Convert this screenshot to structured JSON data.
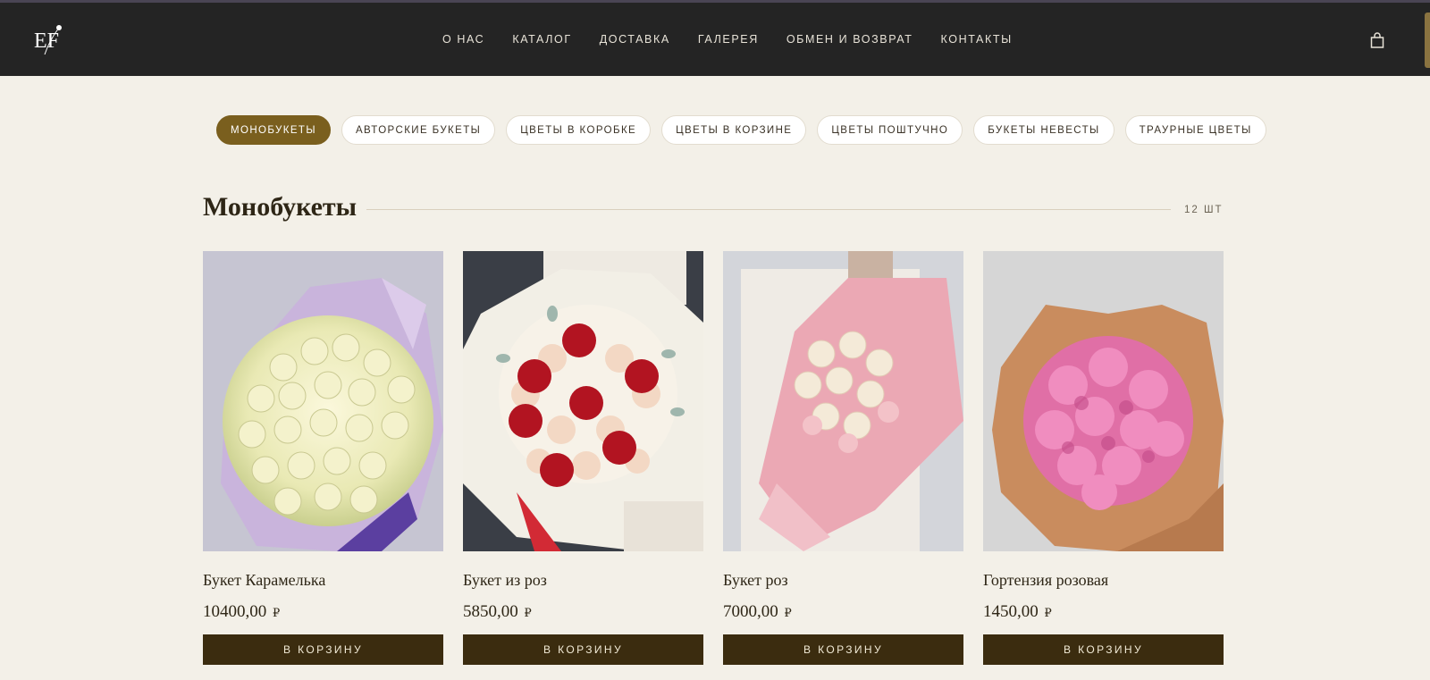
{
  "header": {
    "logo_text": "EF",
    "nav": [
      "О НАС",
      "КАТАЛОГ",
      "ДОСТАВКА",
      "ГАЛЕРЕЯ",
      "ОБМЕН И ВОЗВРАТ",
      "КОНТАКТЫ"
    ],
    "cart_icon": "shopping-bag-icon"
  },
  "filters": [
    {
      "label": "МОНОБУКЕТЫ",
      "active": true
    },
    {
      "label": "АВТОРСКИЕ БУКЕТЫ",
      "active": false
    },
    {
      "label": "ЦВЕТЫ В КОРОБКЕ",
      "active": false
    },
    {
      "label": "ЦВЕТЫ В КОРЗИНЕ",
      "active": false
    },
    {
      "label": "ЦВЕТЫ ПОШТУЧНО",
      "active": false
    },
    {
      "label": "БУКЕТЫ НЕВЕСТЫ",
      "active": false
    },
    {
      "label": "ТРАУРНЫЕ ЦВЕТЫ",
      "active": false
    }
  ],
  "section": {
    "title": "Монобукеты",
    "count": "12 ШТ"
  },
  "products": [
    {
      "name": "Букет Карамелька",
      "price": "10400,00",
      "currency": "₽",
      "button": "В КОРЗИНУ"
    },
    {
      "name": "Букет из роз",
      "price": "5850,00",
      "currency": "₽",
      "button": "В КОРЗИНУ"
    },
    {
      "name": "Букет роз",
      "price": "7000,00",
      "currency": "₽",
      "button": "В КОРЗИНУ"
    },
    {
      "name": "Гортензия розовая",
      "price": "1450,00",
      "currency": "₽",
      "button": "В КОРЗИНУ"
    }
  ],
  "colors": {
    "header_bg": "#242424",
    "page_bg": "#f3f0e8",
    "accent": "#7a5f1e",
    "button_bg": "#3b2c0f"
  }
}
